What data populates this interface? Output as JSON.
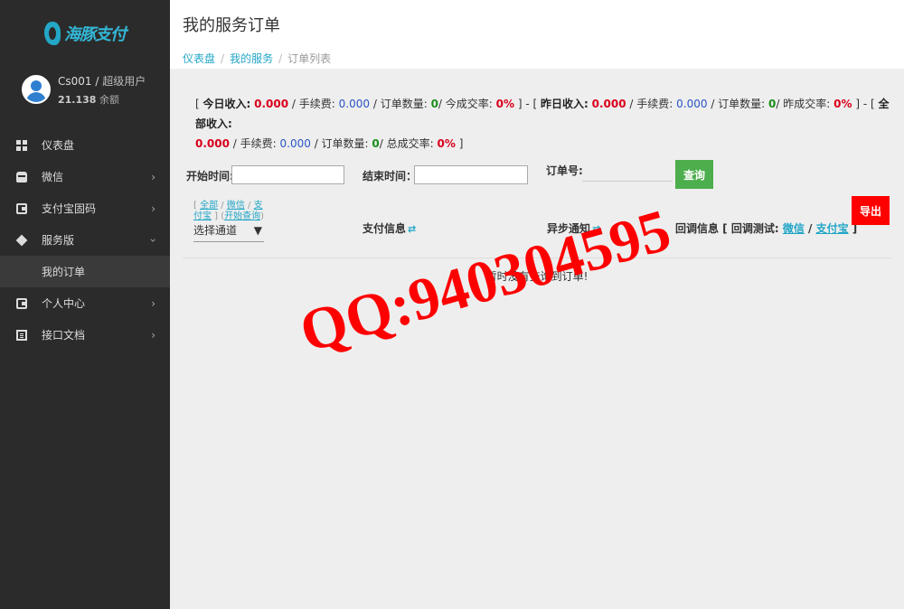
{
  "brand": {
    "logo_text": "海豚支付"
  },
  "user": {
    "name": "Cs001",
    "role": "超级用户",
    "balance": "21.138",
    "balance_label": "余额"
  },
  "nav": [
    {
      "label": "仪表盘",
      "icon": "dashboard-icon",
      "has_chevron": false
    },
    {
      "label": "微信",
      "icon": "wechat-icon",
      "has_chevron": true
    },
    {
      "label": "支付宝固码",
      "icon": "wallet-icon",
      "has_chevron": true
    },
    {
      "label": "服务版",
      "icon": "layers-icon",
      "has_chevron": true
    },
    {
      "label": "我的订单",
      "icon": "",
      "has_chevron": false
    },
    {
      "label": "个人中心",
      "icon": "user-center-icon",
      "has_chevron": true
    },
    {
      "label": "接口文档",
      "icon": "docs-icon",
      "has_chevron": true
    }
  ],
  "page": {
    "title": "我的服务订单",
    "breadcrumb": [
      "仪表盘",
      "我的服务",
      "订单列表"
    ]
  },
  "stats": {
    "today_label": "今日收入:",
    "today_income": "0.000",
    "today_fee_label": "手续费:",
    "today_fee": "0.000",
    "today_count_label": "订单数量:",
    "today_count": "0",
    "today_rate_label": "今成交率:",
    "today_rate": "0%",
    "yest_label": "昨日收入:",
    "yest_income": "0.000",
    "yest_fee_label": "手续费:",
    "yest_fee": "0.000",
    "yest_count_label": "订单数量:",
    "yest_count": "0",
    "yest_rate_label": "昨成交率:",
    "yest_rate": "0%",
    "all_label": "全部收入:",
    "all_income": "0.000",
    "all_fee_label": "手续费:",
    "all_fee": "0.000",
    "all_count_label": "订单数量:",
    "all_count": "0",
    "all_rate_label": "总成交率:",
    "all_rate": "0%"
  },
  "filter": {
    "start_label": "开始时间:",
    "end_label": "结束时间：",
    "order_label": "订单号:",
    "query_button": "查询"
  },
  "table": {
    "channel_links": [
      "全部",
      "微信",
      "支付宝",
      "开始查询"
    ],
    "channel_select": "选择通道",
    "col_pay": "支付信息",
    "col_notify": "异步通知",
    "col_callback": "回调信息 [ 回调测试:",
    "callback_wechat": "微信",
    "callback_alipay": "支付宝",
    "export_button": "导出",
    "empty_text": "暂时没有查询到订单!"
  },
  "watermark": {
    "text": "QQ:940304595",
    "color": "#ff0000"
  }
}
